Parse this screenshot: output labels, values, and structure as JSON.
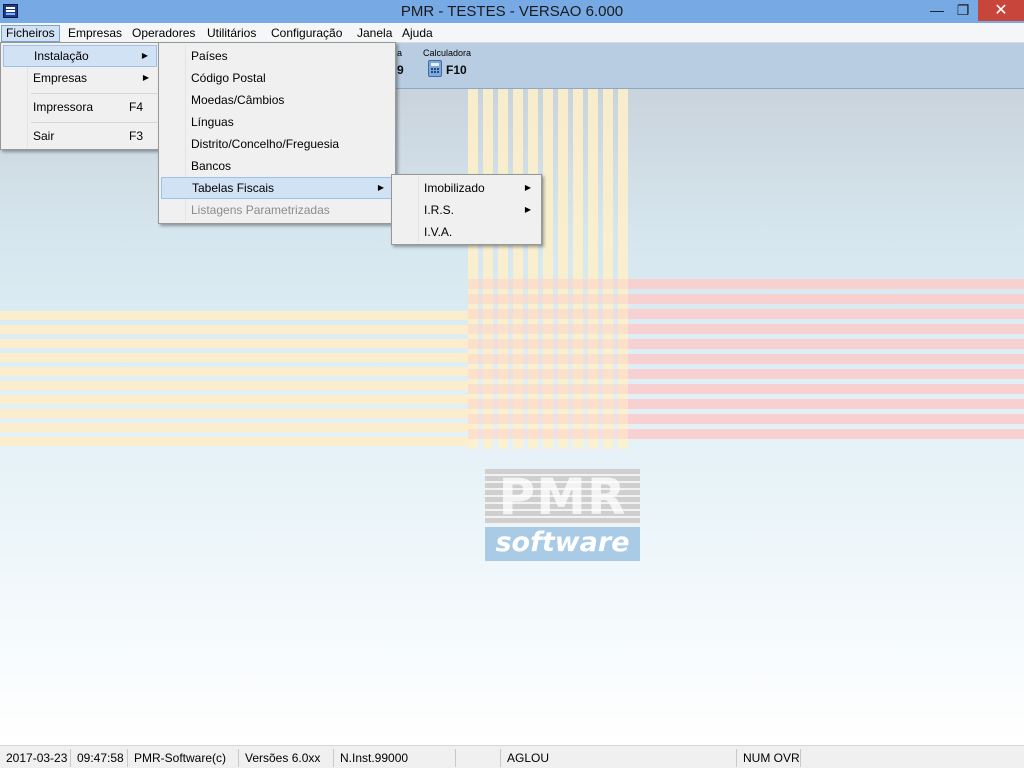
{
  "window": {
    "title": "PMR - TESTES - VERSAO 6.000",
    "minimize_glyph": "—",
    "restore_glyph": "❐",
    "close_glyph": "✕"
  },
  "menubar": [
    "Ficheiros",
    "Empresas",
    "Operadores",
    "Utilitários",
    "Configuração",
    "Janela",
    "Ajuda"
  ],
  "toolbar": {
    "partial_label": "a",
    "partial_key": "9",
    "calc_label": "Calculadora",
    "calc_key": "F10"
  },
  "menu_ficheiros": {
    "items": [
      {
        "label": "Instalação",
        "submenu": true
      },
      {
        "label": "Empresas",
        "submenu": true
      },
      {
        "label": "Impressora",
        "shortcut": "F4"
      },
      {
        "label": "Sair",
        "shortcut": "F3"
      }
    ]
  },
  "menu_instalacao": {
    "items": [
      {
        "label": "Países"
      },
      {
        "label": "Código Postal"
      },
      {
        "label": "Moedas/Câmbios"
      },
      {
        "label": "Línguas"
      },
      {
        "label": "Distrito/Concelho/Freguesia"
      },
      {
        "label": "Bancos"
      },
      {
        "label": "Tabelas Fiscais",
        "submenu": true
      },
      {
        "label": "Listagens Parametrizadas",
        "disabled": true
      }
    ]
  },
  "menu_tabelas": {
    "items": [
      {
        "label": "Imobilizado",
        "submenu": true
      },
      {
        "label": "I.R.S.",
        "submenu": true
      },
      {
        "label": "I.V.A."
      }
    ]
  },
  "logo": {
    "top_text": "PMR",
    "bottom_text": "software"
  },
  "statusbar": {
    "date": "2017-03-23",
    "time": "09:47:58",
    "company": "PMR-Software(c)",
    "version": "Versões 6.0xx",
    "install": "N.Inst.99000",
    "user": "AGLOU",
    "mode": "NUM OVR"
  },
  "arrow_glyph": "▶",
  "colors": {
    "titlebar": "#77a9e4",
    "close_button": "#c7453a",
    "menu_highlight": "#d1e2f5",
    "toolbar": "#b8cde2",
    "logo_sub": "#a9cbe6"
  }
}
